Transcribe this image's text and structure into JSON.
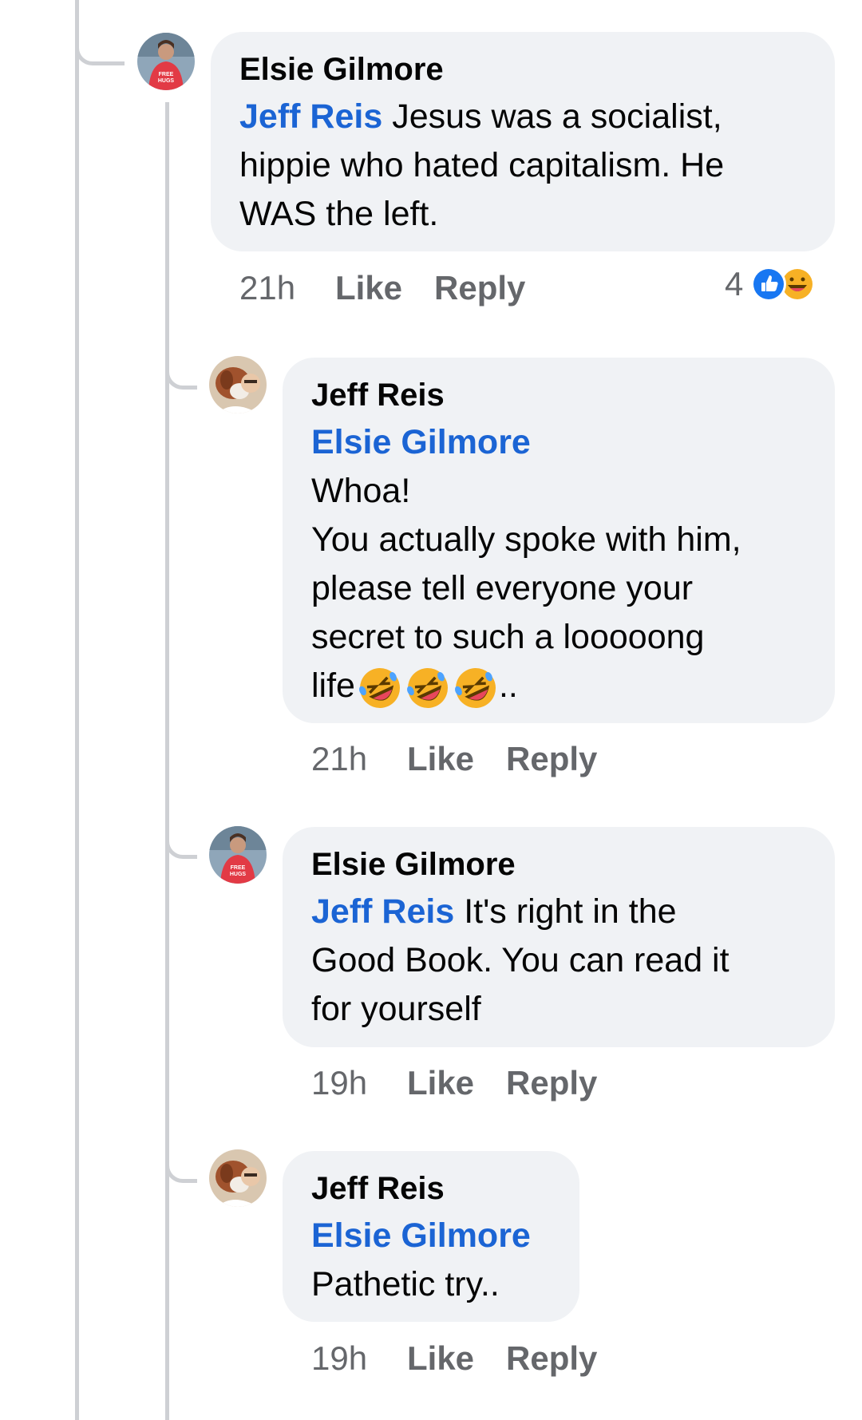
{
  "comments": [
    {
      "author": "Elsie Gilmore",
      "mention": "Jeff Reis",
      "lines": [
        "Jesus was a socialist,",
        "hippie who hated capitalism. He",
        "WAS the left."
      ],
      "time": "21h",
      "like_label": "Like",
      "reply_label": "Reply",
      "reaction_count": "4",
      "reaction_icons": [
        "like-reaction-icon",
        "haha-reaction-icon"
      ],
      "avatar": "avatar-elsie-free-hugs"
    },
    {
      "author": "Jeff Reis",
      "mention": "Elsie Gilmore",
      "lines": [
        "Whoa!",
        "You actually spoke with him,",
        "please tell everyone your",
        "secret to such a looooong"
      ],
      "last_line_prefix": "life",
      "last_line_suffix": "..",
      "emojis": [
        "rolling-laughing-emoji",
        "rolling-laughing-emoji",
        "rolling-laughing-emoji"
      ],
      "time": "21h",
      "like_label": "Like",
      "reply_label": "Reply",
      "avatar": "avatar-jeff-dog"
    },
    {
      "author": "Elsie Gilmore",
      "mention": "Jeff Reis",
      "lines": [
        "It's right in the",
        "Good Book. You can read it",
        "for yourself"
      ],
      "time": "19h",
      "like_label": "Like",
      "reply_label": "Reply",
      "avatar": "avatar-elsie-free-hugs"
    },
    {
      "author": "Jeff Reis",
      "mention": "Elsie Gilmore",
      "lines": [
        "Pathetic try.."
      ],
      "time": "19h",
      "like_label": "Like",
      "reply_label": "Reply",
      "avatar": "avatar-jeff-dog"
    }
  ],
  "colors": {
    "bubble": "#f0f2f5",
    "mention": "#1b64d4",
    "meta": "#65676b",
    "thread_line": "#ced0d4",
    "like_blue": "#1877f2",
    "haha_yellow": "#f7b125"
  }
}
